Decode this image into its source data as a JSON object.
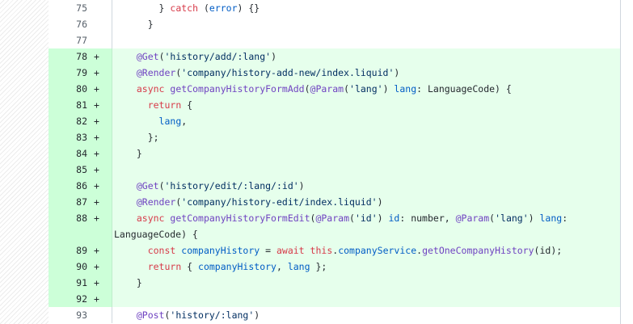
{
  "lines": [
    {
      "num": "75",
      "sign": "",
      "added": false,
      "tokens": [
        {
          "t": "      ",
          "c": "plain"
        },
        {
          "t": "} ",
          "c": "plain"
        },
        {
          "t": "catch",
          "c": "kw"
        },
        {
          "t": " (",
          "c": "plain"
        },
        {
          "t": "error",
          "c": "var"
        },
        {
          "t": ") {}",
          "c": "plain"
        }
      ]
    },
    {
      "num": "76",
      "sign": "",
      "added": false,
      "tokens": [
        {
          "t": "    }",
          "c": "plain"
        }
      ]
    },
    {
      "num": "77",
      "sign": "",
      "added": false,
      "tokens": [
        {
          "t": "",
          "c": "plain"
        }
      ]
    },
    {
      "num": "78",
      "sign": "+",
      "added": true,
      "tokens": [
        {
          "t": "  ",
          "c": "plain"
        },
        {
          "t": "@Get",
          "c": "dec"
        },
        {
          "t": "(",
          "c": "plain"
        },
        {
          "t": "'history/add/:lang'",
          "c": "str"
        },
        {
          "t": ")",
          "c": "plain"
        }
      ]
    },
    {
      "num": "79",
      "sign": "+",
      "added": true,
      "tokens": [
        {
          "t": "  ",
          "c": "plain"
        },
        {
          "t": "@Render",
          "c": "dec"
        },
        {
          "t": "(",
          "c": "plain"
        },
        {
          "t": "'company/history-add-new/index.liquid'",
          "c": "str"
        },
        {
          "t": ")",
          "c": "plain"
        }
      ]
    },
    {
      "num": "80",
      "sign": "+",
      "added": true,
      "tokens": [
        {
          "t": "  ",
          "c": "plain"
        },
        {
          "t": "async",
          "c": "kw"
        },
        {
          "t": " ",
          "c": "plain"
        },
        {
          "t": "getCompanyHistoryFormAdd",
          "c": "fn"
        },
        {
          "t": "(",
          "c": "plain"
        },
        {
          "t": "@Param",
          "c": "dec"
        },
        {
          "t": "(",
          "c": "plain"
        },
        {
          "t": "'lang'",
          "c": "str"
        },
        {
          "t": ") ",
          "c": "plain"
        },
        {
          "t": "lang",
          "c": "var"
        },
        {
          "t": ": LanguageCode) {",
          "c": "plain"
        }
      ]
    },
    {
      "num": "81",
      "sign": "+",
      "added": true,
      "tokens": [
        {
          "t": "    ",
          "c": "plain"
        },
        {
          "t": "return",
          "c": "kw"
        },
        {
          "t": " {",
          "c": "plain"
        }
      ]
    },
    {
      "num": "82",
      "sign": "+",
      "added": true,
      "tokens": [
        {
          "t": "      ",
          "c": "plain"
        },
        {
          "t": "lang",
          "c": "var"
        },
        {
          "t": ",",
          "c": "plain"
        }
      ]
    },
    {
      "num": "83",
      "sign": "+",
      "added": true,
      "tokens": [
        {
          "t": "    };",
          "c": "plain"
        }
      ]
    },
    {
      "num": "84",
      "sign": "+",
      "added": true,
      "tokens": [
        {
          "t": "  }",
          "c": "plain"
        }
      ]
    },
    {
      "num": "85",
      "sign": "+",
      "added": true,
      "tokens": [
        {
          "t": "",
          "c": "plain"
        }
      ]
    },
    {
      "num": "86",
      "sign": "+",
      "added": true,
      "tokens": [
        {
          "t": "  ",
          "c": "plain"
        },
        {
          "t": "@Get",
          "c": "dec"
        },
        {
          "t": "(",
          "c": "plain"
        },
        {
          "t": "'history/edit/:lang/:id'",
          "c": "str"
        },
        {
          "t": ")",
          "c": "plain"
        }
      ]
    },
    {
      "num": "87",
      "sign": "+",
      "added": true,
      "tokens": [
        {
          "t": "  ",
          "c": "plain"
        },
        {
          "t": "@Render",
          "c": "dec"
        },
        {
          "t": "(",
          "c": "plain"
        },
        {
          "t": "'company/history-edit/index.liquid'",
          "c": "str"
        },
        {
          "t": ")",
          "c": "plain"
        }
      ]
    },
    {
      "num": "88",
      "sign": "+",
      "added": true,
      "wrap": true,
      "tokens": [
        {
          "t": "  ",
          "c": "plain"
        },
        {
          "t": "async",
          "c": "kw"
        },
        {
          "t": " ",
          "c": "plain"
        },
        {
          "t": "getCompanyHistoryFormEdit",
          "c": "fn"
        },
        {
          "t": "(",
          "c": "plain"
        },
        {
          "t": "@Param",
          "c": "dec"
        },
        {
          "t": "(",
          "c": "plain"
        },
        {
          "t": "'id'",
          "c": "str"
        },
        {
          "t": ") ",
          "c": "plain"
        },
        {
          "t": "id",
          "c": "var"
        },
        {
          "t": ": number, ",
          "c": "plain"
        },
        {
          "t": "@Param",
          "c": "dec"
        },
        {
          "t": "(",
          "c": "plain"
        },
        {
          "t": "'lang'",
          "c": "str"
        },
        {
          "t": ") ",
          "c": "plain"
        },
        {
          "t": "lang",
          "c": "var"
        },
        {
          "t": ":",
          "c": "plain"
        }
      ],
      "wrap_tokens": [
        {
          "t": "LanguageCode) {",
          "c": "plain"
        }
      ]
    },
    {
      "num": "89",
      "sign": "+",
      "added": true,
      "tokens": [
        {
          "t": "    ",
          "c": "plain"
        },
        {
          "t": "const",
          "c": "kw"
        },
        {
          "t": " ",
          "c": "plain"
        },
        {
          "t": "companyHistory",
          "c": "var"
        },
        {
          "t": " = ",
          "c": "plain"
        },
        {
          "t": "await",
          "c": "kw"
        },
        {
          "t": " ",
          "c": "plain"
        },
        {
          "t": "this",
          "c": "kw"
        },
        {
          "t": ".",
          "c": "plain"
        },
        {
          "t": "companyService",
          "c": "var"
        },
        {
          "t": ".",
          "c": "plain"
        },
        {
          "t": "getOneCompanyHistory",
          "c": "fn"
        },
        {
          "t": "(id);",
          "c": "plain"
        }
      ]
    },
    {
      "num": "90",
      "sign": "+",
      "added": true,
      "tokens": [
        {
          "t": "    ",
          "c": "plain"
        },
        {
          "t": "return",
          "c": "kw"
        },
        {
          "t": " { ",
          "c": "plain"
        },
        {
          "t": "companyHistory",
          "c": "var"
        },
        {
          "t": ", ",
          "c": "plain"
        },
        {
          "t": "lang",
          "c": "var"
        },
        {
          "t": " };",
          "c": "plain"
        }
      ]
    },
    {
      "num": "91",
      "sign": "+",
      "added": true,
      "tokens": [
        {
          "t": "  }",
          "c": "plain"
        }
      ]
    },
    {
      "num": "92",
      "sign": "+",
      "added": true,
      "tokens": [
        {
          "t": "",
          "c": "plain"
        }
      ]
    },
    {
      "num": "93",
      "sign": "",
      "added": false,
      "tokens": [
        {
          "t": "  ",
          "c": "plain"
        },
        {
          "t": "@Post",
          "c": "dec"
        },
        {
          "t": "(",
          "c": "plain"
        },
        {
          "t": "'history/:lang'",
          "c": "str"
        },
        {
          "t": ")",
          "c": "plain"
        }
      ]
    }
  ]
}
